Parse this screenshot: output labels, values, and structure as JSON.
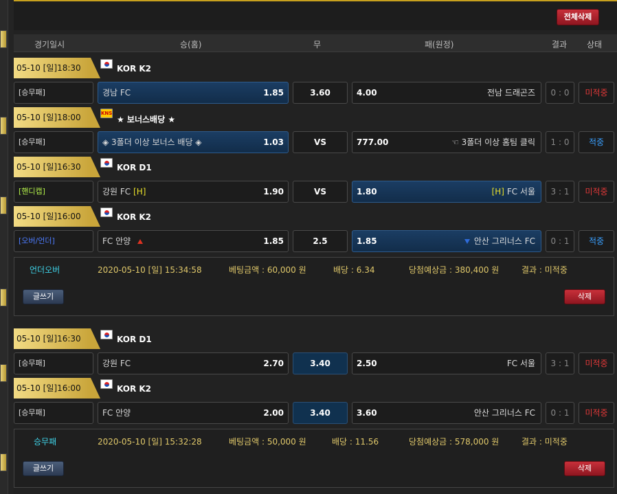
{
  "top": {
    "delete_all": "전체삭제"
  },
  "header": {
    "date": "경기일시",
    "home": "승(홈)",
    "draw": "무",
    "away": "패(원정)",
    "result": "결과",
    "status": "상태"
  },
  "slip1": {
    "games": [
      {
        "date": "05-10 [일]18:30",
        "league": "KOR K2",
        "type": "[승무패]",
        "home": "경남 FC",
        "home_odds": "1.85",
        "draw": "3.60",
        "away_odds": "4.00",
        "away": "전남 드래곤즈",
        "score": "0 : 0",
        "status": "미적중"
      },
      {
        "date": "05-10 [일]18:00",
        "league": "★ 보너스배당 ★",
        "type": "[승무패]",
        "home": "◈ 3폴더 이상 보너스 배당 ◈",
        "home_odds": "1.03",
        "draw": "VS",
        "away_odds": "777.00",
        "away": "☜ 3폴더 이상 홈팀 클릭",
        "score": "1 : 0",
        "status": "적중"
      },
      {
        "date": "05-10 [일]16:30",
        "league": "KOR D1",
        "type": "[핸디캡]",
        "home": "강원 FC",
        "home_tag": "[H]",
        "home_odds": "1.90",
        "draw": "VS",
        "away_odds": "1.80",
        "away_tag": "[H]",
        "away": "FC 서울",
        "score": "3 : 1",
        "status": "미적중"
      },
      {
        "date": "05-10 [일]16:00",
        "league": "KOR K2",
        "type": "[오버/언더]",
        "home": "FC 안양",
        "home_odds": "1.85",
        "draw": "2.5",
        "away_odds": "1.85",
        "away": "안산 그리너스 FC",
        "score": "0 : 1",
        "status": "적중"
      }
    ],
    "summary": {
      "type": "언더오버",
      "time": "2020-05-10 [일] 15:34:58",
      "amount": "베팅금액 : 60,000 원",
      "odds": "배당 : 6.34",
      "expected": "당첨예상금 : 380,400 원",
      "result": "결과 : 미적중",
      "write": "글쓰기",
      "delete": "삭제"
    }
  },
  "slip2": {
    "games": [
      {
        "date": "05-10 [일]16:30",
        "league": "KOR D1",
        "type": "[승무패]",
        "home": "강원 FC",
        "home_odds": "2.70",
        "draw": "3.40",
        "away_odds": "2.50",
        "away": "FC 서울",
        "score": "3 : 1",
        "status": "미적중"
      },
      {
        "date": "05-10 [일]16:00",
        "league": "KOR K2",
        "type": "[승무패]",
        "home": "FC 안양",
        "home_odds": "2.00",
        "draw": "3.40",
        "away_odds": "3.60",
        "away": "안산 그리너스 FC",
        "score": "0 : 1",
        "status": "미적중"
      }
    ],
    "summary": {
      "type": "승무패",
      "time": "2020-05-10 [일] 15:32:28",
      "amount": "베팅금액 : 50,000 원",
      "odds": "배당 : 11.56",
      "expected": "당첨예상금 : 578,000 원",
      "result": "결과 : 미적중",
      "write": "글쓰기",
      "delete": "삭제"
    }
  },
  "colors": {
    "accent_gold": "#c8a11e",
    "win_blue": "#3aa0ff",
    "lose_red": "#e03838",
    "selected_blue": "#1b3d63"
  }
}
